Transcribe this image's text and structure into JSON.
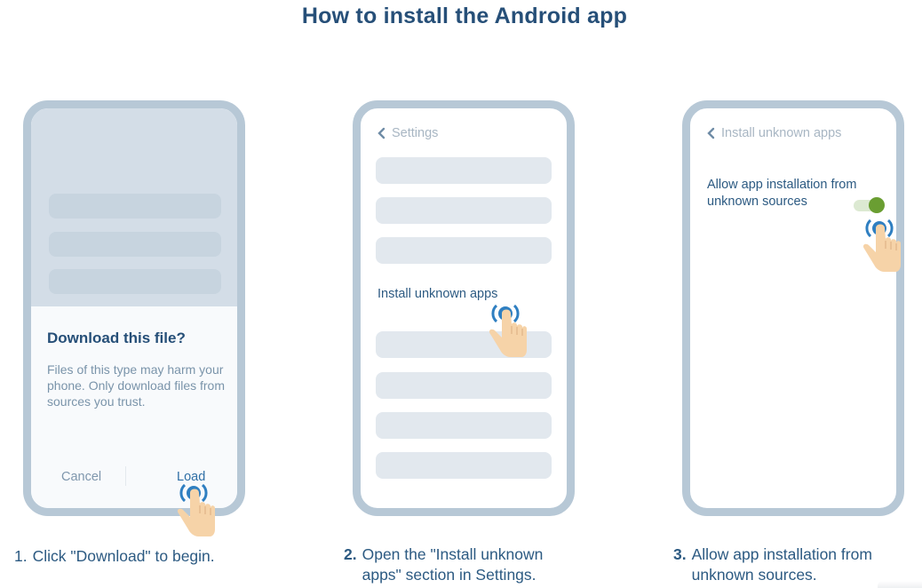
{
  "page": {
    "title": "How to install the Android app"
  },
  "steps": [
    {
      "number": "1.",
      "caption": "Click \"Download\" to begin.",
      "dialog": {
        "title": "Download this file?",
        "body": "Files of this type may harm your phone. Only download files from sources you trust.",
        "cancel_label": "Cancel",
        "confirm_label": "Load"
      }
    },
    {
      "number": "2.",
      "caption": "Open the \"Install unknown apps\" section in Settings.",
      "screen": {
        "back_icon": "chevron-left-icon",
        "header": "Settings",
        "highlight_item": "Install unknown apps"
      }
    },
    {
      "number": "3.",
      "caption": "Allow app installation from unknown sources.",
      "screen": {
        "back_icon": "chevron-left-icon",
        "header": "Install unknown apps",
        "setting_label": "Allow app installation from unknown sources",
        "toggle_on": true
      }
    }
  ],
  "colors": {
    "heading": "#264f78",
    "text": "#2c5a82",
    "phone_frame": "#b7c8d6",
    "toggle_on": "#6a9e32",
    "tap_ring": "#2f7fc1",
    "hand_skin": "#f6d3a8"
  }
}
